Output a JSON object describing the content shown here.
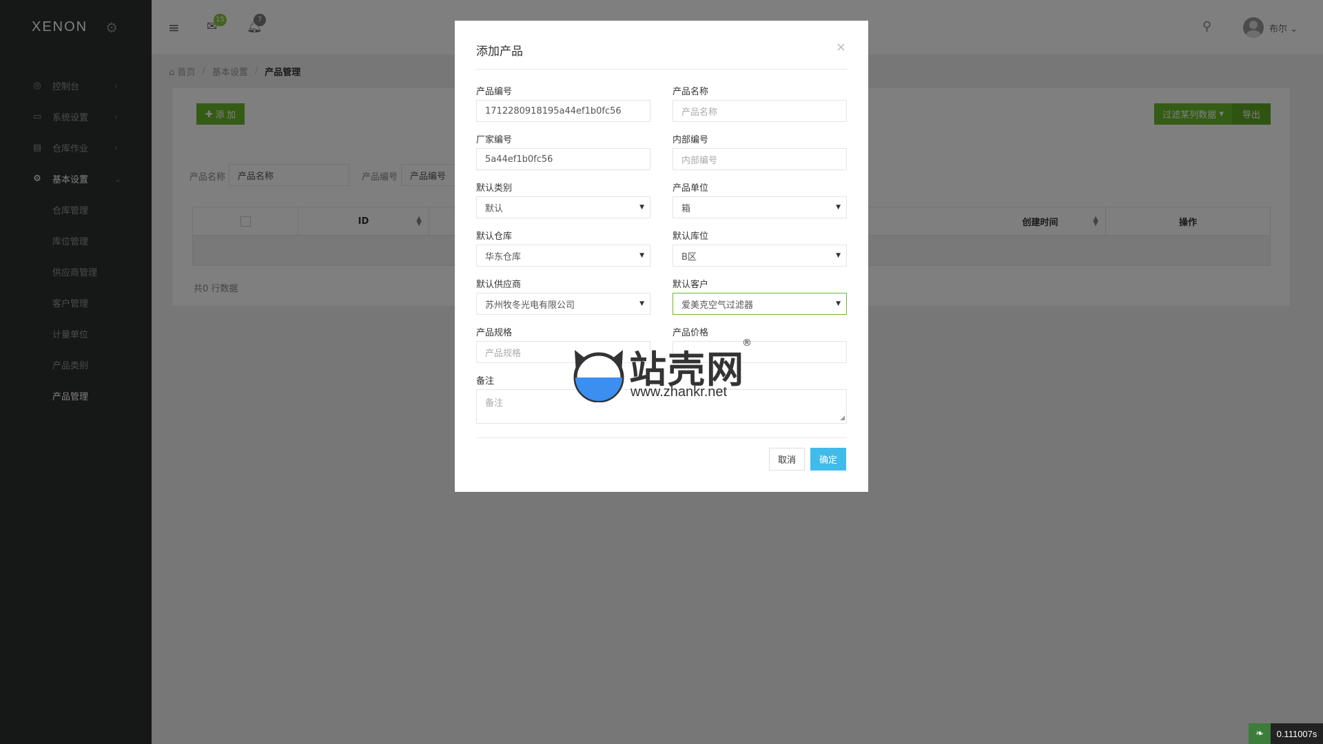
{
  "sidebar": {
    "logo": "XENON",
    "nav": [
      {
        "label": "控制台",
        "icon": "dashboard-icon"
      },
      {
        "label": "系统设置",
        "icon": "monitor-icon"
      },
      {
        "label": "仓库作业",
        "icon": "archive-icon"
      },
      {
        "label": "基本设置",
        "icon": "gear-icon"
      }
    ],
    "sub": [
      "仓库管理",
      "库位管理",
      "供应商管理",
      "客户管理",
      "计量单位",
      "产品类别",
      "产品管理"
    ]
  },
  "topbar": {
    "mail_count": "15",
    "notify_count": "7",
    "user_name": "布尔"
  },
  "breadcrumb": {
    "home": "首页",
    "section": "基本设置",
    "current": "产品管理"
  },
  "main": {
    "add_label": "添 加",
    "filter_label": "过滤某列数据",
    "export_label": "导出",
    "search": {
      "name_label": "产品名称",
      "name_value": "产品名称",
      "code_label": "产品编号",
      "code_value": "产品编号"
    },
    "columns": [
      "ID",
      "创建时间",
      "操作"
    ],
    "count_text": "共0 行数据"
  },
  "modal": {
    "title": "添加产品",
    "close": "×",
    "fields": {
      "product_code": {
        "label": "产品编号",
        "value": "1712280918195a44ef1b0fc56"
      },
      "product_name": {
        "label": "产品名称",
        "placeholder": "产品名称"
      },
      "vendor_code": {
        "label": "厂家编号",
        "value": "5a44ef1b0fc56"
      },
      "internal_code": {
        "label": "内部编号",
        "placeholder": "内部编号"
      },
      "category": {
        "label": "默认类别",
        "value": "默认"
      },
      "unit": {
        "label": "产品单位",
        "value": "箱"
      },
      "warehouse": {
        "label": "默认仓库",
        "value": "华东仓库"
      },
      "location": {
        "label": "默认库位",
        "value": "B区"
      },
      "supplier": {
        "label": "默认供应商",
        "value": "苏州牧冬光电有限公司"
      },
      "customer": {
        "label": "默认客户",
        "value": "爱美克空气过滤器"
      },
      "spec": {
        "label": "产品规格",
        "placeholder": "产品规格"
      },
      "price": {
        "label": "产品价格",
        "placeholder": ""
      },
      "remark": {
        "label": "备注",
        "placeholder": "备注"
      }
    },
    "cancel_label": "取消",
    "ok_label": "确定"
  },
  "watermark": {
    "text": "站壳网",
    "reg": "®",
    "url": "www.zhankr.net"
  },
  "timer": "0.111007s",
  "colors": {
    "sidebar": "#2c2e2f",
    "accent_green": "#68b828",
    "accent_blue": "#40bbea"
  }
}
